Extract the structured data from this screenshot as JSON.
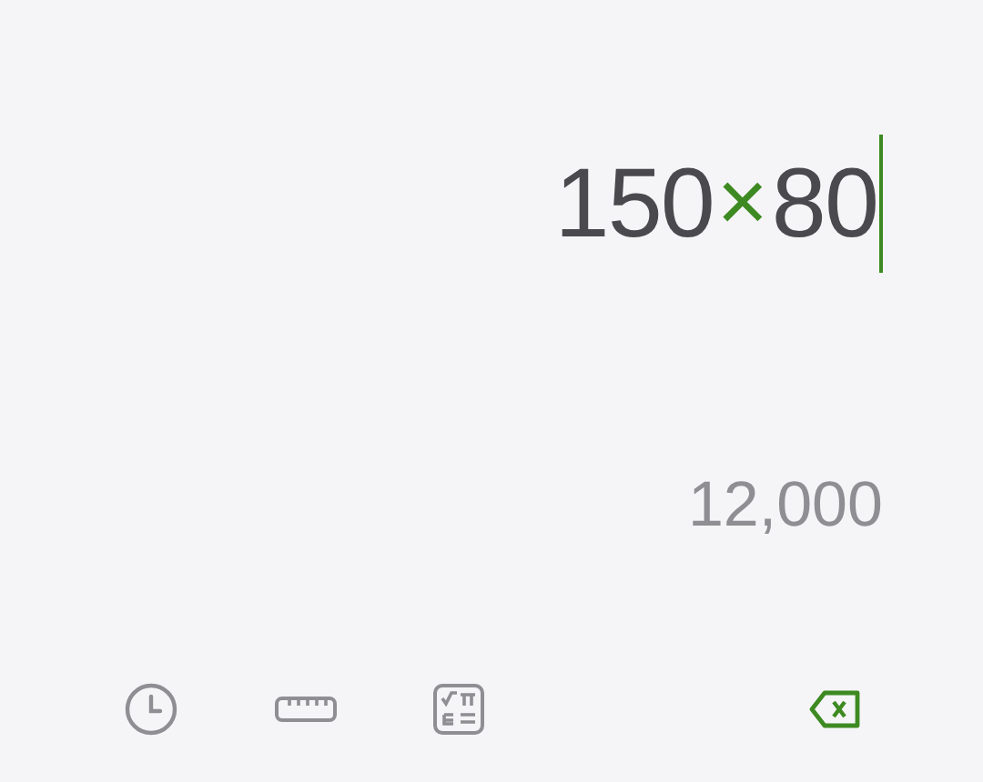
{
  "expression": [
    {
      "kind": "number",
      "text": "150"
    },
    {
      "kind": "operator",
      "text": "×"
    },
    {
      "kind": "number",
      "text": "80"
    }
  ],
  "cursor_visible": true,
  "result": "12,000"
}
